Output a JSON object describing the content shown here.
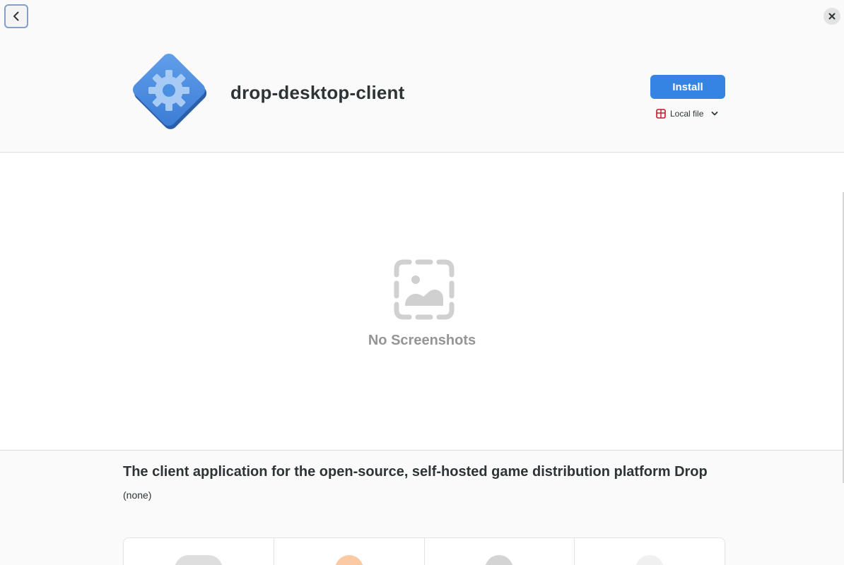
{
  "header": {
    "back_icon": "chevron-left-icon",
    "close_icon": "close-icon"
  },
  "app": {
    "name": "drop-desktop-client",
    "icon": "gear-diamond-icon",
    "install_label": "Install",
    "source_label": "Local file",
    "source_icon": "package-icon",
    "source_dropdown_icon": "chevron-down-icon"
  },
  "screenshots": {
    "empty_icon": "image-missing-icon",
    "empty_label": "No Screenshots"
  },
  "details": {
    "summary": "The client application for the open-source, self-hosted game distribution platform Drop",
    "description": "(none)"
  },
  "tiles": [
    {
      "icon": "grey-badge-icon"
    },
    {
      "icon": "orange-badge-icon"
    },
    {
      "icon": "dark-badge-icon"
    },
    {
      "icon": "light-badge-icon"
    }
  ],
  "colors": {
    "accent": "#3584e4",
    "icon_blue": "#4a90e2"
  }
}
